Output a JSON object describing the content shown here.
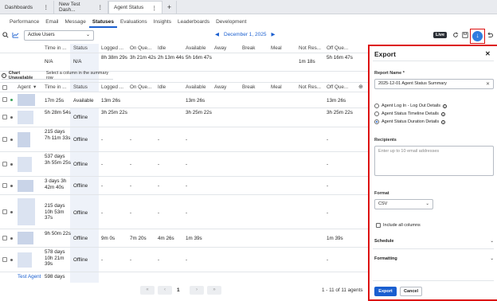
{
  "top_tabs": [
    {
      "label": "Dashboards"
    },
    {
      "label": "New Test Dash..."
    },
    {
      "label": "Agent Status"
    }
  ],
  "subnav": [
    "Performance",
    "Email",
    "Message",
    "Statuses",
    "Evaluations",
    "Insights",
    "Leaderboards",
    "Development"
  ],
  "toolbar": {
    "filter_value": "Active Users",
    "date": "December 1, 2025",
    "live_label": "Live"
  },
  "summary": {
    "headers": [
      "Time in ...",
      "Status",
      "Logged ...",
      "On Que...",
      "Idle",
      "Available",
      "Away",
      "Break",
      "Meal",
      "Not Res...",
      "Off Que..."
    ],
    "values": [
      "N/A",
      "N/A",
      "8h 38m 29s",
      "3h 21m 42s",
      "2h 13m 44s",
      "5h 16m 47s",
      "",
      "",
      "",
      "1m 18s",
      "5h 16m 47s"
    ]
  },
  "banner": {
    "bold": "Chart Unavailable",
    "text": "Select a column in the summary row"
  },
  "table": {
    "headers": [
      "Agent",
      "Time in ...",
      "Status",
      "Logged ...",
      "On Que...",
      "Idle",
      "Available",
      "Away",
      "Break",
      "Meal",
      "Not Res...",
      "Off Que..."
    ],
    "rows": [
      {
        "agent": "",
        "time": "17m 25s",
        "status": "Available",
        "logged": "13m 26s",
        "on_queue": "",
        "idle": "",
        "available": "13m 26s",
        "off_queue": "13m 26s",
        "dot": "green"
      },
      {
        "agent": "",
        "time": "5h 28m 54s",
        "status": "Offline",
        "logged": "3h 25m 22s",
        "on_queue": "",
        "idle": "",
        "available": "3h 25m 22s",
        "off_queue": "3h 25m 22s",
        "dot": "grey"
      },
      {
        "agent": "",
        "time": "215 days 7h 11m 33s",
        "status": "Offline",
        "logged": "-",
        "on_queue": "-",
        "idle": "-",
        "available": "-",
        "off_queue": "-",
        "dot": "grey"
      },
      {
        "agent": "",
        "time": "537 days 3h 55m 25s",
        "status": "Offline",
        "logged": "-",
        "on_queue": "-",
        "idle": "-",
        "available": "-",
        "off_queue": "-",
        "dot": "grey"
      },
      {
        "agent": "",
        "time": "3 days 3h 42m 40s",
        "status": "Offline",
        "logged": "-",
        "on_queue": "-",
        "idle": "-",
        "available": "-",
        "off_queue": "-",
        "dot": "grey"
      },
      {
        "agent": "",
        "time": "215 days 10h 53m 37s",
        "status": "Offline",
        "logged": "-",
        "on_queue": "-",
        "idle": "-",
        "available": "-",
        "off_queue": "-",
        "dot": "grey"
      },
      {
        "agent": "",
        "time": "9h 50m 22s",
        "status": "Offline",
        "logged": "9m 0s",
        "on_queue": "7m 20s",
        "idle": "4m 26s",
        "available": "1m 39s",
        "off_queue": "1m 39s",
        "dot": "grey"
      },
      {
        "agent": "",
        "time": "578 days 10h 21m 39s",
        "status": "Offline",
        "logged": "-",
        "on_queue": "-",
        "idle": "-",
        "available": "-",
        "off_queue": "-",
        "dot": "grey"
      },
      {
        "agent": "Test Agent",
        "time": "598 days",
        "status": "",
        "logged": "",
        "on_queue": "",
        "idle": "",
        "available": "",
        "off_queue": "",
        "dot": "none"
      }
    ]
  },
  "pager": {
    "page": "1",
    "count": "1 - 11 of 11 agents"
  },
  "export_panel": {
    "title": "Export",
    "report_name_label": "Report Name *",
    "report_name_value": "2025-12-01 Agent Status Summary",
    "options": [
      {
        "label": "Agent Log In - Log Out Details",
        "selected": false
      },
      {
        "label": "Agent Status Timeline Details",
        "selected": false
      },
      {
        "label": "Agent Status Duration Details",
        "selected": true
      }
    ],
    "recipients_label": "Recipients",
    "recipients_placeholder": "Enter up to 10 email addresses",
    "format_label": "Format",
    "format_value": "CSV",
    "include_all_columns": "Include all columns",
    "schedule_label": "Schedule",
    "formatting_label": "Formatting",
    "export_button": "Export",
    "cancel_button": "Cancel"
  },
  "colors": {
    "accent": "#1a5fd0",
    "highlight": "#dd1111",
    "available_dot": "#3aa35a"
  }
}
